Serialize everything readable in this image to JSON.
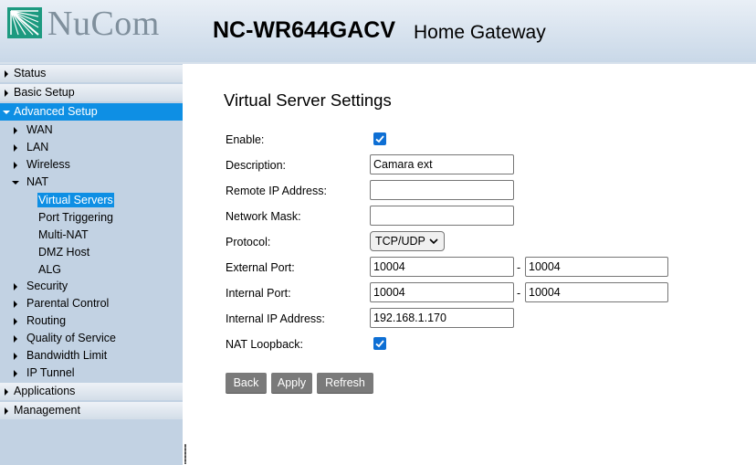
{
  "header": {
    "brand": "NuCom",
    "model": "NC-WR644GACV",
    "subtitle": "Home Gateway",
    "logo_icon": "nucom-logo-icon",
    "brand_color": "#1d9a80"
  },
  "sidebar": {
    "items": {
      "status": "Status",
      "basic_setup": "Basic Setup",
      "advanced_setup": "Advanced Setup",
      "wan": "WAN",
      "lan": "LAN",
      "wireless": "Wireless",
      "nat": "NAT",
      "virtual_servers": "Virtual Servers",
      "port_triggering": "Port Triggering",
      "multi_nat": "Multi-NAT",
      "dmz_host": "DMZ Host",
      "alg": "ALG",
      "security": "Security",
      "parental_control": "Parental Control",
      "routing": "Routing",
      "qos": "Quality of Service",
      "bandwidth_limit": "Bandwidth Limit",
      "ip_tunnel": "IP Tunnel",
      "applications": "Applications",
      "management": "Management"
    },
    "active_color": "#0e8fe4"
  },
  "main": {
    "title": "Virtual Server Settings",
    "labels": {
      "enable": "Enable:",
      "description": "Description:",
      "remote_ip": "Remote IP Address:",
      "network_mask": "Network Mask:",
      "protocol": "Protocol:",
      "external_port": "External Port:",
      "internal_port": "Internal Port:",
      "internal_ip": "Internal IP Address:",
      "nat_loopback": "NAT Loopback:"
    },
    "values": {
      "enable": true,
      "description": "Camara ext",
      "remote_ip": "",
      "network_mask": "",
      "protocol": "TCP/UDP",
      "external_port_start": "10004",
      "external_port_end": "10004",
      "internal_port_start": "10004",
      "internal_port_end": "10004",
      "internal_ip": "192.168.1.170",
      "nat_loopback": true
    },
    "range_separator": "-",
    "buttons": {
      "back": "Back",
      "apply": "Apply",
      "refresh": "Refresh"
    }
  }
}
